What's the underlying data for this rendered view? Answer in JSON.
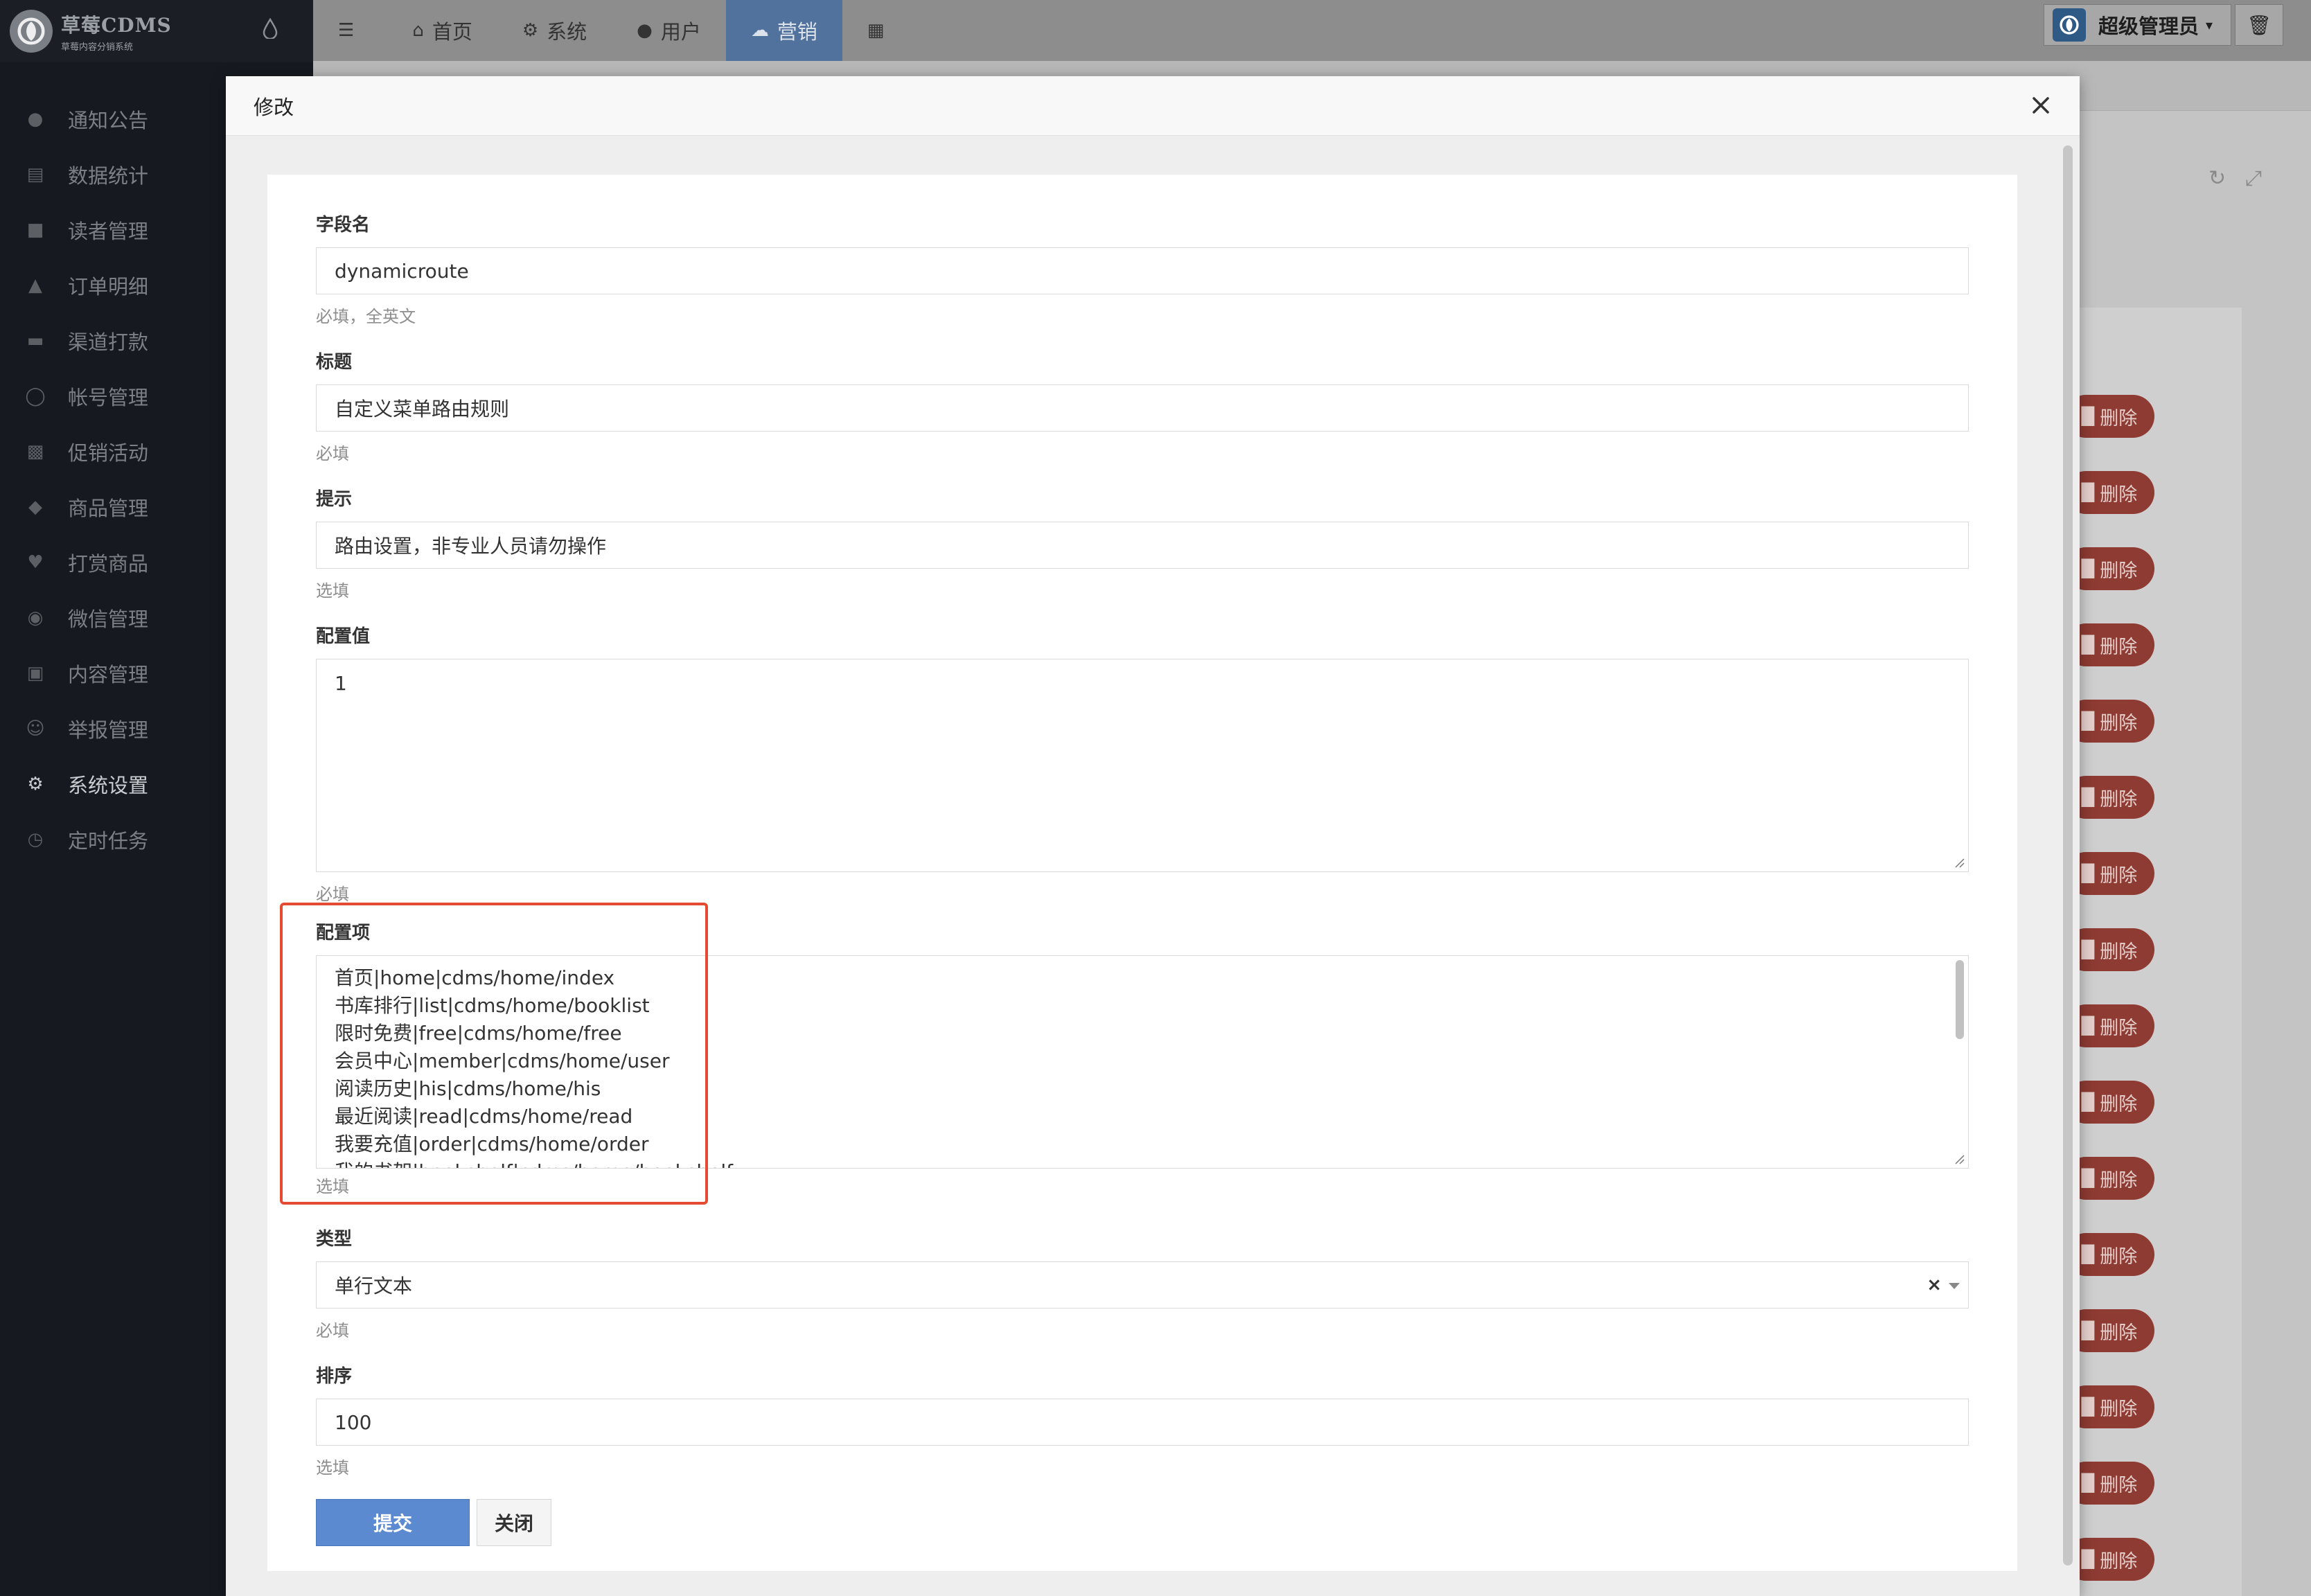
{
  "brand": {
    "name": "草莓CDMS",
    "tagline": "草莓内容分销系统"
  },
  "sidebar": {
    "items": [
      {
        "label": "通知公告",
        "icon": "comment-icon"
      },
      {
        "label": "数据统计",
        "icon": "bar-chart-icon"
      },
      {
        "label": "读者管理",
        "icon": "lock-icon"
      },
      {
        "label": "订单明细",
        "icon": "cart-icon"
      },
      {
        "label": "渠道打款",
        "icon": "keyboard-icon"
      },
      {
        "label": "帐号管理",
        "icon": "user-icon"
      },
      {
        "label": "促销活动",
        "icon": "briefcase-icon"
      },
      {
        "label": "商品管理",
        "icon": "diamond-icon"
      },
      {
        "label": "打赏商品",
        "icon": "heart-icon"
      },
      {
        "label": "微信管理",
        "icon": "wechat-icon"
      },
      {
        "label": "内容管理",
        "icon": "book-icon"
      },
      {
        "label": "举报管理",
        "icon": "smile-icon"
      },
      {
        "label": "系统设置",
        "icon": "gear-icon",
        "active": true
      },
      {
        "label": "定时任务",
        "icon": "clock-icon"
      }
    ]
  },
  "topnav": {
    "items": [
      {
        "label": "首页",
        "icon": "home-icon"
      },
      {
        "label": "系统",
        "icon": "gear-icon"
      },
      {
        "label": "用户",
        "icon": "user-icon"
      },
      {
        "label": "营销",
        "icon": "cloud-icon",
        "active": true
      }
    ],
    "admin_label": "超级管理员"
  },
  "background_table": {
    "delete_label": "删除",
    "row_count": 16
  },
  "modal": {
    "title": "修改",
    "fields": {
      "name": {
        "label": "字段名",
        "value": "dynamicroute",
        "hint": "必填，全英文"
      },
      "title": {
        "label": "标题",
        "value": "自定义菜单路由规则",
        "hint": "必填"
      },
      "tip": {
        "label": "提示",
        "value": "路由设置，非专业人员请勿操作",
        "hint": "选填"
      },
      "config_value": {
        "label": "配置值",
        "value": "1",
        "hint": "必填"
      },
      "config_items": {
        "label": "配置项",
        "lines": [
          "首页|home|cdms/home/index",
          "书库排行|list|cdms/home/booklist",
          "限时免费|free|cdms/home/free",
          "会员中心|member|cdms/home/user",
          "阅读历史|his|cdms/home/his",
          "最近阅读|read|cdms/home/read",
          "我要充值|order|cdms/home/order",
          "我的书架|bookshelf|cdms/home/bookshelf"
        ],
        "hint": "选填"
      },
      "type": {
        "label": "类型",
        "value": "单行文本",
        "hint": "必填"
      },
      "sort": {
        "label": "排序",
        "value": "100",
        "hint": "选填"
      }
    },
    "buttons": {
      "submit": "提交",
      "close": "关闭"
    }
  },
  "colors": {
    "highlight_border": "#e44b32",
    "primary_button": "#5b8ad1",
    "danger_button": "#8e3b33"
  }
}
